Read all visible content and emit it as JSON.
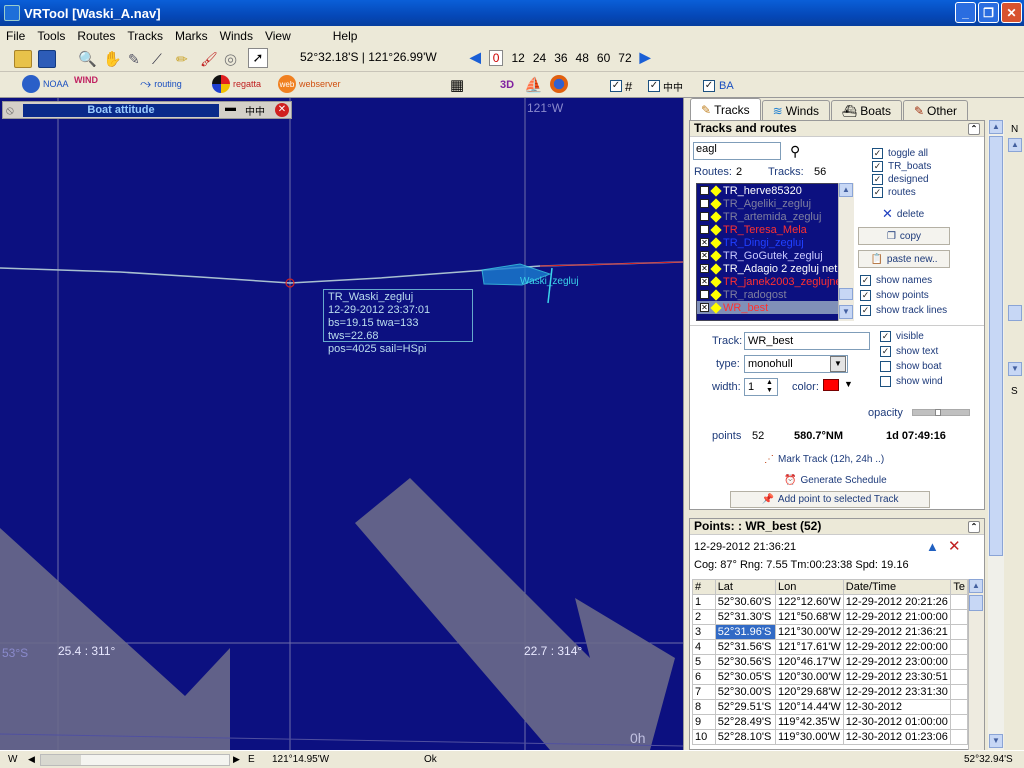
{
  "window": {
    "title": "VRTool [Waski_A.nav]"
  },
  "menu": [
    "File",
    "Tools",
    "Routes",
    "Tracks",
    "Marks",
    "Winds",
    "View",
    "Help"
  ],
  "toolbar": {
    "position": "52°32.18'S | 121°26.99'W",
    "hours": [
      "0",
      "12",
      "24",
      "36",
      "48",
      "60",
      "72"
    ],
    "brands": {
      "noaa": "NOAA",
      "wind": "WIND",
      "routing": "routing",
      "regatta": "regatta",
      "web": "web",
      "webserver": "webserver"
    },
    "label_3d": "3D",
    "label_ba": "BA"
  },
  "map": {
    "attitude_title": "Boat attitude",
    "meridian_label": "121°W",
    "lat_label": "53°S",
    "wind1": "25.4 : 311°",
    "wind2": "22.7 : 314°",
    "time_label": "0h",
    "boat_name": "Waski_zegluj",
    "tooltip": [
      "TR_Waski_zegluj",
      "12-29-2012 23:37:01",
      "bs=19.15 twa=133 tws=22.68",
      " pos=4025 sail=HSpi"
    ]
  },
  "tabs": [
    "Tracks",
    "Winds",
    "Boats",
    "Other"
  ],
  "tracks_panel": {
    "title": "Tracks and routes",
    "search": "eagl",
    "routes_label": "Routes:",
    "routes_count": "2",
    "tracks_label": "Tracks:",
    "tracks_count": "56",
    "items": [
      {
        "name": "TR_herve85320",
        "checked": false,
        "color": "#ffffff"
      },
      {
        "name": "TR_Ageliki_zegluj",
        "checked": false,
        "color": "#7f7f9f"
      },
      {
        "name": "TR_artemida_zegluj",
        "checked": false,
        "color": "#7f7f9f"
      },
      {
        "name": "TR_Teresa_Mela",
        "checked": false,
        "color": "#ff3030"
      },
      {
        "name": "TR_Dingi_zegluj",
        "checked": true,
        "color": "#2040ff"
      },
      {
        "name": "TR_GoGutek_zegluj",
        "checked": true,
        "color": "#c8c8ff"
      },
      {
        "name": "TR_Adagio 2 zegluj net",
        "checked": true,
        "color": "#ffffff"
      },
      {
        "name": "TR_janek2003_zeglujne",
        "checked": true,
        "color": "#ff3030"
      },
      {
        "name": "TR_radogost",
        "checked": false,
        "color": "#7f7f9f"
      },
      {
        "name": "WR_best",
        "checked": true,
        "color": "#ff3030"
      }
    ],
    "toggles": [
      "toggle all",
      "TR_boats",
      "designed",
      "routes"
    ],
    "buttons": {
      "delete": "delete",
      "copy": "copy",
      "paste": "paste new.."
    },
    "show": [
      "show names",
      "show points",
      "show track lines"
    ],
    "track_label": "Track:",
    "track_value": "WR_best",
    "type_label": "type:",
    "type_value": "monohull",
    "width_label": "width:",
    "width_value": "1",
    "color_label": "color:",
    "visible_opts": [
      "visible",
      "show text",
      "show boat",
      "show wind"
    ],
    "opacity_label": "opacity",
    "points_label": "points",
    "points_value": "52",
    "distance": "580.7°NM",
    "duration": "1d 07:49:16",
    "mark_track": "Mark Track (12h, 24h ..)",
    "gen_schedule": "Generate Schedule",
    "add_point": "Add point to selected Track"
  },
  "points_panel": {
    "title": "Points: : WR_best (52)",
    "timestamp": "12-29-2012 21:36:21",
    "info": "Cog: 87° Rng: 7.55 Tm:00:23:38 Spd: 19.16",
    "columns": [
      "#",
      "Lat",
      "Lon",
      "Date/Time",
      "Te"
    ],
    "rows": [
      [
        "1",
        "52°30.60'S",
        "122°12.60'W",
        "12-29-2012 20:21:26"
      ],
      [
        "2",
        "52°31.30'S",
        "121°50.68'W",
        "12-29-2012 21:00:00"
      ],
      [
        "3",
        "52°31.96'S",
        "121°30.00'W",
        "12-29-2012 21:36:21"
      ],
      [
        "4",
        "52°31.56'S",
        "121°17.61'W",
        "12-29-2012 22:00:00"
      ],
      [
        "5",
        "52°30.56'S",
        "120°46.17'W",
        "12-29-2012 23:00:00"
      ],
      [
        "6",
        "52°30.05'S",
        "120°30.00'W",
        "12-29-2012 23:30:51"
      ],
      [
        "7",
        "52°30.00'S",
        "120°29.68'W",
        "12-29-2012 23:31:30"
      ],
      [
        "8",
        "52°29.51'S",
        "120°14.44'W",
        "12-30-2012"
      ],
      [
        "9",
        "52°28.49'S",
        "119°42.35'W",
        "12-30-2012 01:00:00"
      ],
      [
        "10",
        "52°28.10'S",
        "119°30.00'W",
        "12-30-2012 01:23:06"
      ]
    ]
  },
  "compass": {
    "n": "N",
    "s": "S"
  },
  "status": {
    "w": "W",
    "e": "E",
    "lon": "121°14.95'W",
    "ok": "Ok",
    "lat": "52°32.94'S"
  }
}
